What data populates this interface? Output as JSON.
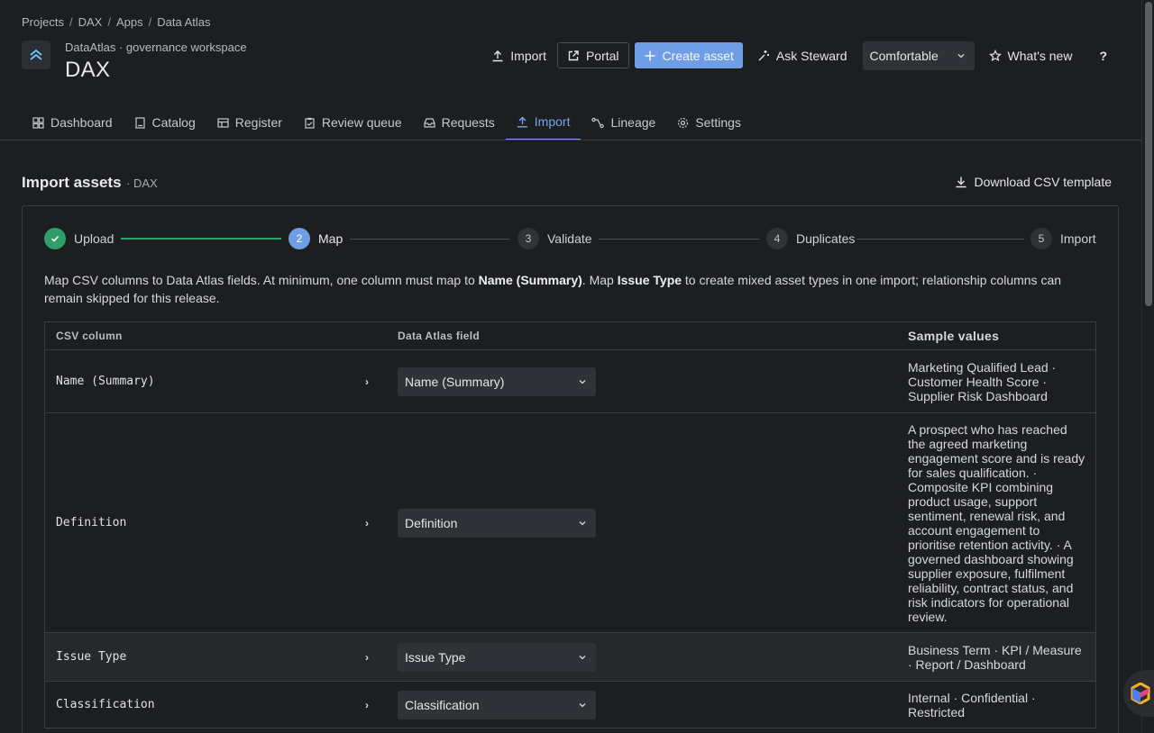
{
  "breadcrumb": [
    "Projects",
    "DAX",
    "Apps",
    "Data Atlas"
  ],
  "workspace": {
    "subtitle": "DataAtlas · governance workspace",
    "title": "DAX"
  },
  "header_actions": {
    "import": "Import",
    "portal": "Portal",
    "create": "Create asset",
    "ask": "Ask Steward",
    "density": "Comfortable",
    "whats_new": "What's new",
    "help": "?"
  },
  "tabs": [
    {
      "label": "Dashboard",
      "icon": "dashboard-icon"
    },
    {
      "label": "Catalog",
      "icon": "catalog-icon"
    },
    {
      "label": "Register",
      "icon": "register-icon"
    },
    {
      "label": "Review queue",
      "icon": "clipboard-icon"
    },
    {
      "label": "Requests",
      "icon": "inbox-icon"
    },
    {
      "label": "Import",
      "icon": "upload-icon",
      "active": true
    },
    {
      "label": "Lineage",
      "icon": "lineage-icon"
    },
    {
      "label": "Settings",
      "icon": "gear-icon"
    }
  ],
  "section": {
    "title": "Import assets",
    "subtitle": "· DAX",
    "download": "Download CSV template"
  },
  "steps": [
    {
      "num": "",
      "label": "Upload",
      "state": "done"
    },
    {
      "num": "2",
      "label": "Map",
      "state": "current"
    },
    {
      "num": "3",
      "label": "Validate",
      "state": "todo"
    },
    {
      "num": "4",
      "label": "Duplicates",
      "state": "todo"
    },
    {
      "num": "5",
      "label": "Import",
      "state": "todo"
    }
  ],
  "intro": {
    "p1": "Map CSV columns to Data Atlas fields. At minimum, one column must map to ",
    "b1": "Name (Summary)",
    "p2": ". Map ",
    "b2": "Issue Type",
    "p3": " to create mixed asset types in one import; relationship columns can remain skipped for this release."
  },
  "table": {
    "headers": [
      "CSV column",
      "Data Atlas field",
      "Sample values"
    ],
    "rows": [
      {
        "column": "Name (Summary)",
        "field": "Name (Summary)",
        "sample": "Marketing Qualified Lead · Customer Health Score · Supplier Risk Dashboard"
      },
      {
        "column": "Definition",
        "field": "Definition",
        "sample": "A prospect who has reached the agreed marketing engagement score and is ready for sales qualification. · Composite KPI combining product usage, support sentiment, renewal risk, and account engagement to prioritise retention activity. · A governed dashboard showing supplier exposure, fulfilment reliability, contract status, and risk indicators for operational review."
      },
      {
        "column": "Issue Type",
        "field": "Issue Type",
        "sample": "Business Term · KPI / Measure · Report / Dashboard"
      },
      {
        "column": "Classification",
        "field": "Classification",
        "sample": "Internal · Confidential · Restricted"
      }
    ]
  },
  "colors": {
    "accent": "#74a5f0",
    "primary_button": "#6f9ee6",
    "success": "#2f9e6a",
    "background": "#1d1e20"
  }
}
